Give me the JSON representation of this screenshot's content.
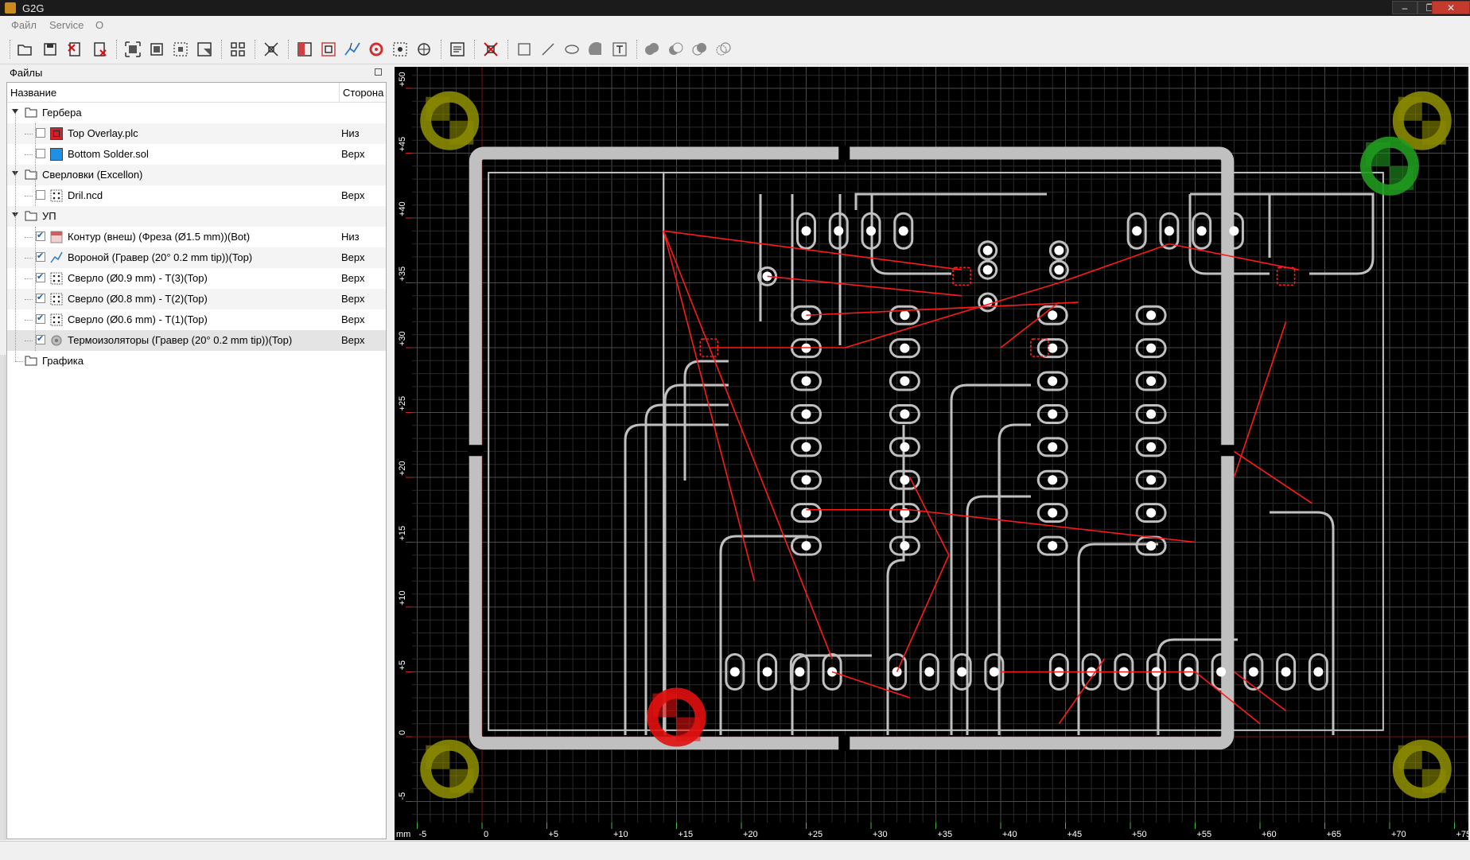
{
  "window": {
    "title": "G2G",
    "minimize": "–",
    "maximize": "❐",
    "close": "✕"
  },
  "menu": [
    "Файл",
    "Service",
    "O"
  ],
  "toolbar_icons": [
    "open-icon",
    "save-icon",
    "close-file-icon",
    "close-all-icon",
    "zoom-fit-icon",
    "zoom-to-icon",
    "zoom-select-icon",
    "zoom-all-icon",
    "group-icon",
    "ungroup-icon",
    "pocket-icon",
    "profile-icon",
    "voronoi-icon",
    "thermal-icon",
    "drill-icon",
    "cut-icon",
    "gcode-icon",
    "point-icon",
    "rect-icon",
    "line-icon",
    "ellipse-icon",
    "arc-icon",
    "text-icon",
    "union-icon",
    "difference-icon",
    "intersect-icon",
    "xor-icon"
  ],
  "files_panel": {
    "title": "Файлы",
    "col_name": "Название",
    "col_side": "Сторона",
    "rows": [
      {
        "kind": "folder",
        "label": "Гербера"
      },
      {
        "kind": "file",
        "label": "Top Overlay.plc",
        "side": "Низ",
        "checked": false,
        "color": "#d4202a",
        "icon": "gerber-red-icon"
      },
      {
        "kind": "file",
        "label": "Bottom Solder.sol",
        "side": "Верх",
        "checked": false,
        "color": "#1e90e6",
        "icon": "gerber-blue-icon"
      },
      {
        "kind": "folder",
        "label": "Сверловки (Excellon)"
      },
      {
        "kind": "file",
        "label": "Dril.ncd",
        "side": "Верх",
        "checked": false,
        "icon": "drill-file-icon"
      },
      {
        "kind": "folder",
        "label": "УП"
      },
      {
        "kind": "file",
        "label": "Контур (внеш) (Фреза (Ø1.5 mm))(Bot)",
        "side": "Низ",
        "checked": true,
        "icon": "profile-toolpath-icon"
      },
      {
        "kind": "file",
        "label": "Вороной (Гравер (20° 0.2 mm tip))(Top)",
        "side": "Верх",
        "checked": true,
        "icon": "voronoi-toolpath-icon"
      },
      {
        "kind": "file",
        "label": "Сверло (Ø0.9 mm) - T(3)(Top)",
        "side": "Верх",
        "checked": true,
        "icon": "drill-toolpath-icon"
      },
      {
        "kind": "file",
        "label": "Сверло (Ø0.8 mm) - T(2)(Top)",
        "side": "Верх",
        "checked": true,
        "icon": "drill-toolpath-icon"
      },
      {
        "kind": "file",
        "label": "Сверло (Ø0.6 mm) - T(1)(Top)",
        "side": "Верх",
        "checked": true,
        "icon": "drill-toolpath-icon"
      },
      {
        "kind": "file",
        "label": "Термоизоляторы (Гравер (20° 0.2 mm tip))(Top)",
        "side": "Верх",
        "checked": true,
        "icon": "thermal-toolpath-icon"
      },
      {
        "kind": "folder",
        "label": "Графика"
      }
    ]
  },
  "canvas": {
    "unit_label": "mm",
    "x_ticks": [
      "-5",
      "0",
      "+5",
      "+10",
      "+15",
      "+20",
      "+25",
      "+30",
      "+35",
      "+40",
      "+45",
      "+50",
      "+55",
      "+60",
      "+65",
      "+70",
      "+75"
    ],
    "y_ticks": [
      "+50",
      "+45",
      "+40",
      "+35",
      "+30",
      "+25",
      "+20",
      "+15",
      "+10",
      "+5",
      "0",
      "-5"
    ],
    "colors": {
      "background": "#000000",
      "board": "#c0c0c0",
      "path": "#ff1a1a",
      "grid": "#2a2a2a",
      "grid_major": "#4a4a4a",
      "marker_yellow": "#8a8a00",
      "marker_green": "#1f9a1f",
      "marker_red": "#e01010"
    }
  }
}
